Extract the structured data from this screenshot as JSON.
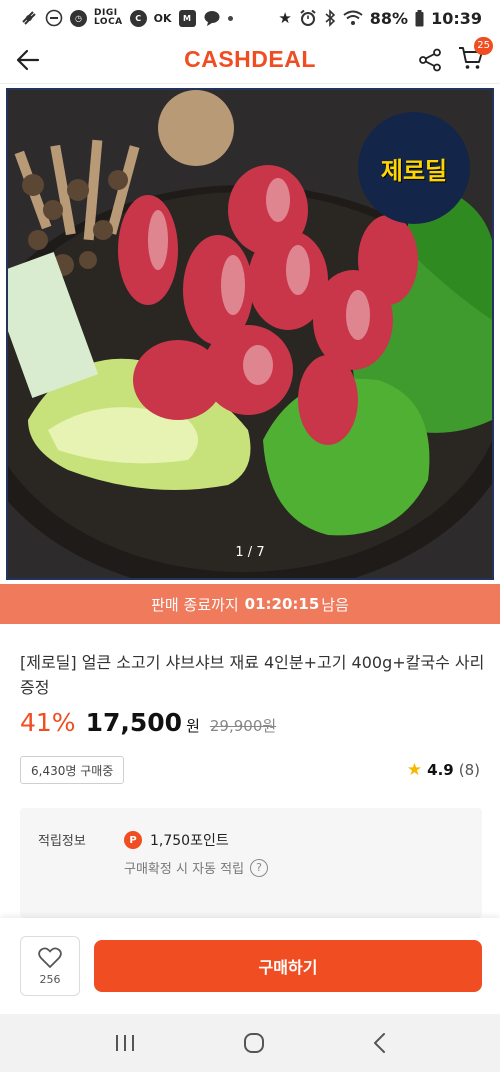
{
  "status_bar": {
    "left_icons": [
      "silent-icon",
      "minus-circle-icon",
      "clock-icon",
      "digi-loca-icon",
      "c-icon",
      "ok-icon",
      "m-stock-icon",
      "chat-icon"
    ],
    "digi_loca_line1": "DIGI",
    "digi_loca_line2": "LOCA",
    "battery": "88%",
    "time": "10:39"
  },
  "header": {
    "logo": "CASHDEAL",
    "cart_count": "25"
  },
  "hero": {
    "badge": "제로딜",
    "pager": "1 / 7"
  },
  "timer": {
    "prefix": "판매 종료까지",
    "time": "01:20:15",
    "suffix": "남음"
  },
  "product": {
    "title": "[제로딜] 얼큰 소고기 샤브샤브 재료 4인분+고기 400g+칼국수 사리 증정",
    "discount": "41%",
    "price": "17,500",
    "price_unit": "원",
    "original_price": "29,900원",
    "buyers": "6,430명 구매중",
    "rating_score": "4.9",
    "rating_count": "(8)"
  },
  "points": {
    "label": "적립정보",
    "amount": "1,750포인트",
    "note": "구매확정 시 자동 적립",
    "p_letter": "P",
    "q_mark": "?"
  },
  "bottom_bar": {
    "like_count": "256",
    "buy_label": "구매하기"
  },
  "colors": {
    "brand": "#f04d22",
    "timer_bg": "#f07a5c",
    "badge_bg": "#14254a"
  }
}
